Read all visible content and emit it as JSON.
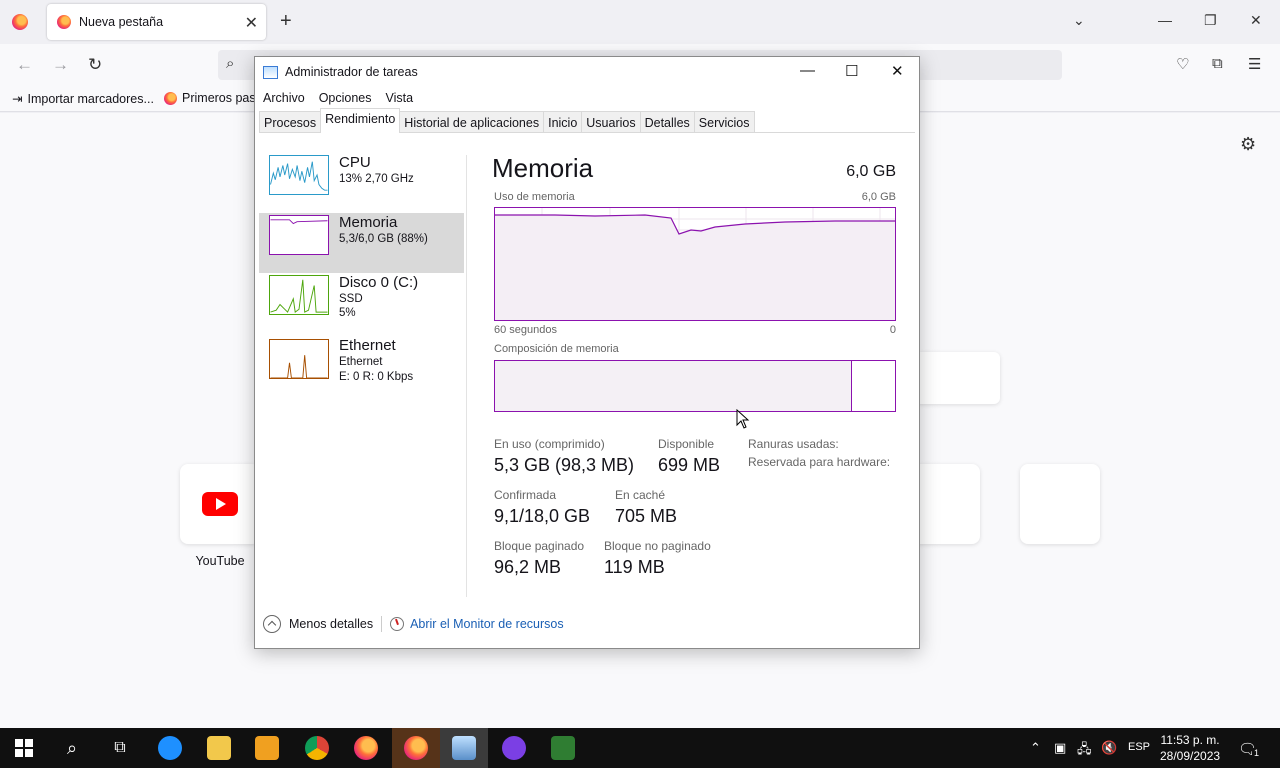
{
  "browser": {
    "tab_title": "Nueva pestaña",
    "tab_close": "✕",
    "new_tab": "+",
    "bookmarks": [
      {
        "label": "Importar marcadores..."
      },
      {
        "label": "Primeros pas"
      }
    ],
    "shortcuts": [
      {
        "label": "YouTube"
      }
    ]
  },
  "taskmanager": {
    "title": "Administrador de tareas",
    "menu": [
      "Archivo",
      "Opciones",
      "Vista"
    ],
    "tabs": [
      "Procesos",
      "Rendimiento",
      "Historial de aplicaciones",
      "Inicio",
      "Usuarios",
      "Detalles",
      "Servicios"
    ],
    "active_tab": "Rendimiento",
    "resources": [
      {
        "name": "CPU",
        "line1": "13% 2,70 GHz",
        "line2": ""
      },
      {
        "name": "Memoria",
        "line1": "5,3/6,0 GB (88%)",
        "line2": ""
      },
      {
        "name": "Disco 0 (C:)",
        "line1": "SSD",
        "line2": "5%"
      },
      {
        "name": "Ethernet",
        "line1": "Ethernet",
        "line2": "E: 0 R: 0 Kbps"
      }
    ],
    "memory": {
      "title": "Memoria",
      "total": "6,0 GB",
      "usage_label": "Uso de memoria",
      "usage_max": "6,0 GB",
      "time_left": "60 segundos",
      "time_right": "0",
      "composition_label": "Composición de memoria",
      "stats": {
        "in_use_label": "En uso (comprimido)",
        "in_use_value": "5,3 GB (98,3 MB)",
        "available_label": "Disponible",
        "available_value": "699 MB",
        "slots_label": "Ranuras usadas:",
        "reserved_label": "Reservada para hardware:",
        "committed_label": "Confirmada",
        "committed_value": "9,1/18,0 GB",
        "cached_label": "En caché",
        "cached_value": "705 MB",
        "paged_label": "Bloque paginado",
        "paged_value": "96,2 MB",
        "nonpaged_label": "Bloque no paginado",
        "nonpaged_value": "119 MB"
      }
    },
    "footer": {
      "less_details": "Menos detalles",
      "resource_monitor": "Abrir el Monitor de recursos"
    }
  },
  "taskbar": {
    "lang": "ESP",
    "time": "11:53 p. m.",
    "date": "28/09/2023",
    "notif_count": "1"
  },
  "colors": {
    "memory_accent": "#8b12ae",
    "cpu_accent": "#2a9ac9",
    "disk_accent": "#4da60c",
    "ethernet_accent": "#a74f01"
  }
}
